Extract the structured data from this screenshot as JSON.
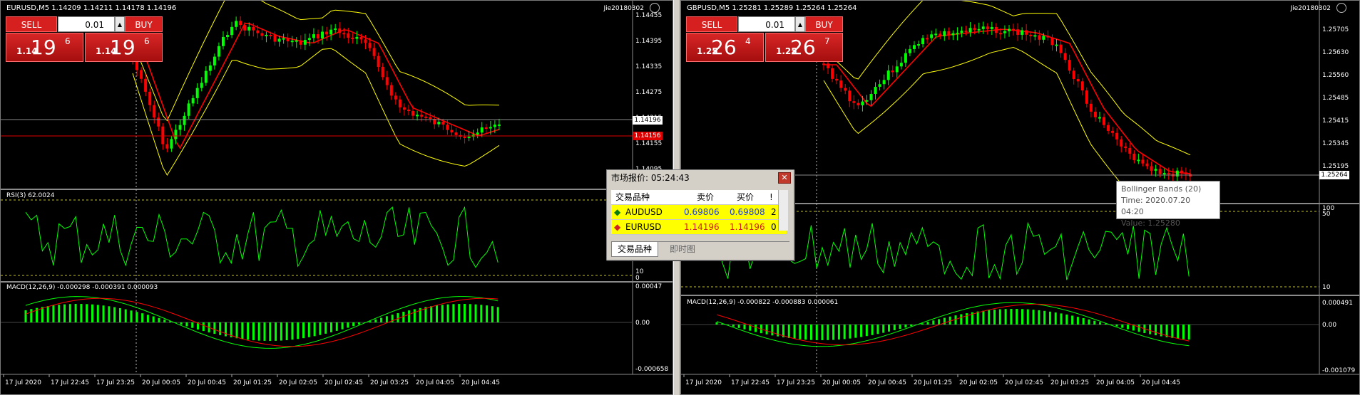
{
  "left": {
    "title": "EURUSD,M5  1.14209 1.14211 1.14178 1.14196",
    "account": "Jie20180302",
    "trade": {
      "sell": "SELL",
      "buy": "BUY",
      "lot": "0.01",
      "sell_price": {
        "pre": "1.14",
        "big": "19",
        "sup": "6"
      },
      "buy_price": {
        "pre": "1.14",
        "big": "19",
        "sup": "6"
      }
    },
    "price_axis": [
      "1.14455",
      "1.14395",
      "1.14335",
      "1.14275",
      "1.14215",
      "1.14155",
      "1.14095"
    ],
    "current_price": "1.14196",
    "red_line_price": "1.14156",
    "rsi_title": "RSI(3) 62.0024",
    "rsi_axis": [
      "10",
      "0"
    ],
    "macd_title": "MACD(12,26,9) -0.000298 -0.000391 0.000093",
    "macd_axis": [
      "0.00047",
      "0.00",
      "-0.000658"
    ],
    "time_axis": [
      "17 Jul 2020",
      "17 Jul 22:45",
      "17 Jul 23:25",
      "20 Jul 00:05",
      "20 Jul 00:45",
      "20 Jul 01:25",
      "20 Jul 02:05",
      "20 Jul 02:45",
      "20 Jul 03:25",
      "20 Jul 04:05",
      "20 Jul 04:45"
    ]
  },
  "right": {
    "title": "GBPUSD,M5  1.25281 1.25289 1.25264 1.25264",
    "account": "Jie20180302",
    "trade": {
      "sell": "SELL",
      "buy": "BUY",
      "lot": "0.01",
      "sell_price": {
        "pre": "1.25",
        "big": "26",
        "sup": "4"
      },
      "buy_price": {
        "pre": "1.25",
        "big": "26",
        "sup": "7"
      }
    },
    "price_axis": [
      "1.25705",
      "1.25630",
      "1.25560",
      "1.25485",
      "1.25415",
      "1.25345",
      "1.25195"
    ],
    "current_price": "1.25264",
    "rsi_axis": [
      "100",
      "50",
      "10"
    ],
    "macd_title": "MACD(12,26,9) -0.000822 -0.000883 0.000061",
    "macd_axis": [
      "0.000491",
      "0.00",
      "-0.001079"
    ],
    "time_axis": [
      "17 Jul 2020",
      "17 Jul 22:45",
      "17 Jul 23:25",
      "20 Jul 00:05",
      "20 Jul 00:45",
      "20 Jul 01:25",
      "20 Jul 02:05",
      "20 Jul 02:45",
      "20 Jul 03:25",
      "20 Jul 04:05",
      "20 Jul 04:45"
    ]
  },
  "market_watch": {
    "title": "市场报价: 05:24:43",
    "headers": {
      "symbol": "交易品种",
      "bid": "卖价",
      "ask": "买价",
      "spread": "!"
    },
    "rows": [
      {
        "symbol": "AUDUSD",
        "bid": "0.69806",
        "ask": "0.69808",
        "spread": "2"
      },
      {
        "symbol": "EURUSD",
        "bid": "1.14196",
        "ask": "1.14196",
        "spread": "0"
      }
    ],
    "tabs": [
      "交易品种",
      "即时图"
    ]
  },
  "tooltip": {
    "line1": "Bollinger Bands (20)",
    "line2": "Time: 2020.07.20 04:20",
    "line3": "Value: 1.25280"
  },
  "colors": {
    "bull": "#00ff00",
    "bear": "#ff0000",
    "band": "#ffff00",
    "ma": "#ff0000",
    "bg": "#000000",
    "trade_red": "#d62020"
  }
}
